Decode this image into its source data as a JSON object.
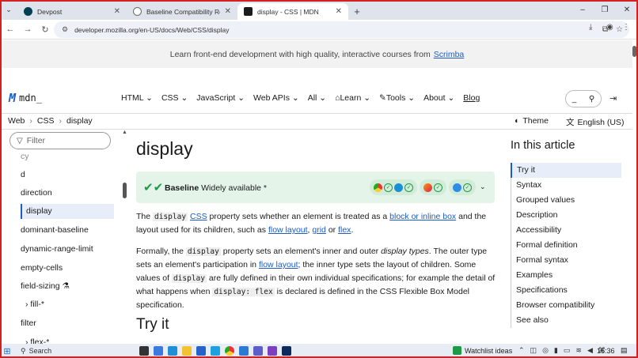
{
  "browser": {
    "tabs": [
      {
        "title": "Devpost",
        "active": false,
        "favicon_color": "#003e54"
      },
      {
        "title": "Baseline Compatibility Report",
        "active": false,
        "favicon_color": "#6b6b6b"
      },
      {
        "title": "display - CSS | MDN",
        "active": true,
        "favicon_color": "#1b1b1b"
      }
    ],
    "url": "developer.mozilla.org/en-US/docs/Web/CSS/display",
    "new_tab_glyph": "+",
    "window_controls": [
      "–",
      "❐",
      "✕"
    ]
  },
  "banner": {
    "text": "Learn front-end development with high quality, interactive courses from",
    "link": "Scrimba"
  },
  "header": {
    "logo_text": "mdn_",
    "nav": [
      "HTML",
      "CSS",
      "JavaScript",
      "Web APIs",
      "All",
      "Learn",
      "Tools",
      "About",
      "Blog"
    ],
    "search_glyph": "_"
  },
  "breadcrumb": [
    "Web",
    "CSS",
    "display"
  ],
  "toolbar_right": {
    "theme": "Theme",
    "language": "English (US)"
  },
  "sidebar": {
    "filter_placeholder": "Filter",
    "items": [
      {
        "label": "cy"
      },
      {
        "label": "d"
      },
      {
        "label": "direction"
      },
      {
        "label": "display",
        "active": true
      },
      {
        "label": "dominant-baseline"
      },
      {
        "label": "dynamic-range-limit"
      },
      {
        "label": "empty-cells"
      },
      {
        "label": "field-sizing"
      },
      {
        "label": "fill-*",
        "group": true
      },
      {
        "label": "filter"
      },
      {
        "label": "flex-*",
        "group": true
      }
    ]
  },
  "article": {
    "title": "display",
    "baseline": {
      "label": "Baseline",
      "status": "Widely available",
      "asterisk": "*"
    },
    "p1": {
      "t1": "The",
      "code1": "display",
      "link1": "CSS",
      "t2": "property sets whether an element is treated as a",
      "link2": "block or inline box",
      "t3": "and the layout used for its children, such as",
      "link3": "flow layout",
      "t4": ",",
      "link4": "grid",
      "t5": "or",
      "link5": "flex",
      "t6": "."
    },
    "p2": {
      "t1": "Formally, the",
      "code1": "display",
      "t2": "property sets an element's inner and outer",
      "em1": "display types",
      "t3": ". The outer type sets an element's participation in",
      "link1": "flow layout",
      "t4": "; the inner type sets the layout of children. Some values of",
      "code2": "display",
      "t5": "are fully defined in their own individual specifications; for example the detail of what happens when",
      "code3": "display: flex",
      "t6": "is declared is defined in the CSS Flexible Box Model specification."
    },
    "h2": "Try it"
  },
  "toc": {
    "title": "In this article",
    "items": [
      "Try it",
      "Syntax",
      "Grouped values",
      "Description",
      "Accessibility",
      "Formal definition",
      "Formal syntax",
      "Examples",
      "Specifications",
      "Browser compatibility",
      "See also"
    ]
  },
  "taskbar": {
    "search": "Search",
    "widget": "Watchlist ideas",
    "time": "16:36"
  }
}
